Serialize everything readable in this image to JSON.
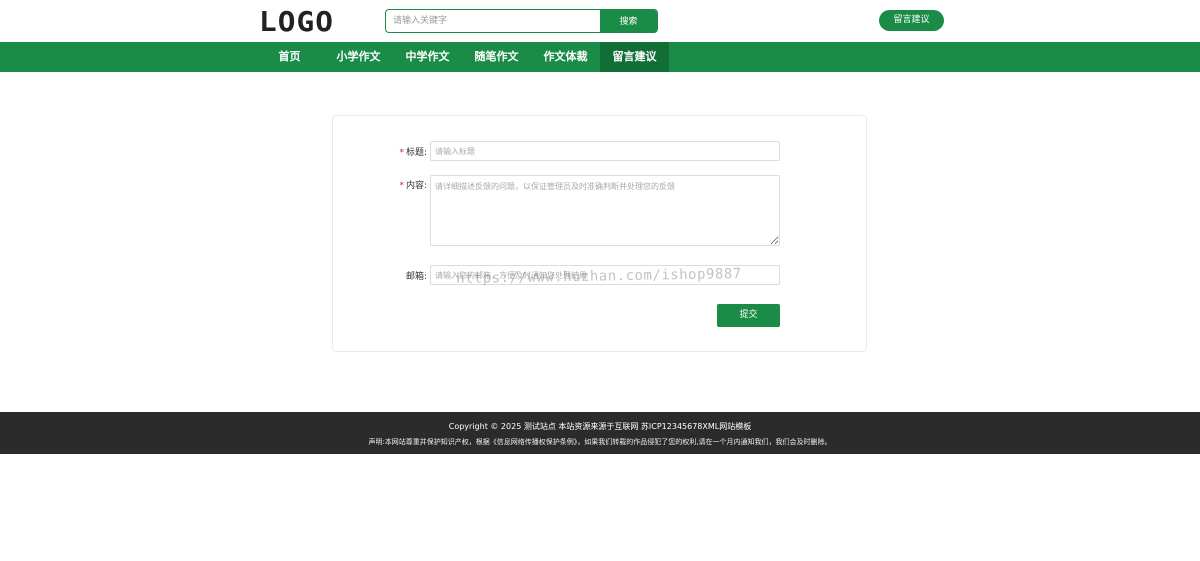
{
  "header": {
    "logo_text": "LOGO",
    "search": {
      "placeholder": "请输入关键字",
      "button_label": "搜索"
    },
    "feedback_button": "留言建议"
  },
  "nav": {
    "items": [
      {
        "label": "首页",
        "active": false
      },
      {
        "label": "小学作文",
        "active": false
      },
      {
        "label": "中学作文",
        "active": false
      },
      {
        "label": "随笔作文",
        "active": false
      },
      {
        "label": "作文体裁",
        "active": false
      },
      {
        "label": "留言建议",
        "active": true
      }
    ]
  },
  "form": {
    "title_field": {
      "required_mark": "*",
      "label": "标题:",
      "placeholder": "请输入标题"
    },
    "content_field": {
      "required_mark": "*",
      "label": "内容:",
      "placeholder": "请详细描述反馈的问题，以保证管理员及时准确判断并处理您的反馈"
    },
    "email_field": {
      "label": "邮箱:",
      "placeholder": "请输入您的邮箱，方便及时通知您处理结果"
    },
    "submit_label": "提交"
  },
  "watermark": "https://www.huzhan.com/ishop9887",
  "footer": {
    "copyright": "Copyright © 2025 测试站点 本站资源来源于互联网 苏ICP12345678XML网站模板",
    "notice": "声明:本网站尊重并保护知识产权，根据《信息网络传播权保护条例》，如果我们转载的作品侵犯了您的权利,请在一个月内通知我们，我们会及时删除。"
  },
  "colors": {
    "brand_green": "#1a8c48",
    "nav_active": "#126e37",
    "footer_bg": "#2b2b2b",
    "required": "#e02020"
  }
}
